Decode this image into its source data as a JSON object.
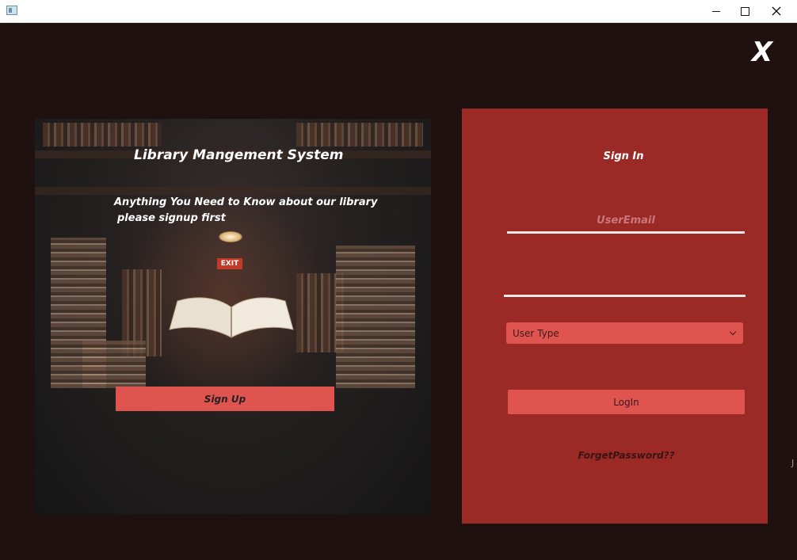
{
  "window": {
    "close_overlay": "X"
  },
  "left_panel": {
    "title": "Library Mangement System",
    "subtitle_line1": "Anything You Need to Know about our library",
    "subtitle_line2": "please signup first",
    "signup_label": "Sign Up",
    "exit_sign": "EXIT"
  },
  "sign_in": {
    "title": "Sign In",
    "email_placeholder": "UserEmail",
    "user_type_label": "User Type",
    "login_label": "LogIn",
    "forget_label": "ForgetPassword??"
  },
  "colors": {
    "background": "#1f1110",
    "panel": "#9b2a27",
    "accent": "#e05450"
  },
  "edge_char": "J"
}
